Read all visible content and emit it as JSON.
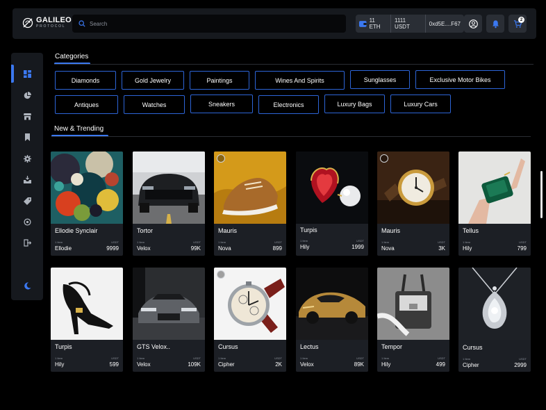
{
  "header": {
    "logo_name": "GALILEO",
    "logo_sub": "PROTOCOL",
    "search_placeholder": "Search",
    "wallet": {
      "eth": "11 ETH",
      "usdt": "1111 USDT",
      "address": "0xd5E....F67"
    },
    "notification_count": "",
    "cart_count": "2"
  },
  "sidebar": {
    "items": [
      {
        "icon": "dashboard-icon",
        "active": true
      },
      {
        "icon": "pie-chart-icon"
      },
      {
        "icon": "store-icon"
      },
      {
        "icon": "bookmark-icon"
      },
      {
        "icon": "settings-icon"
      },
      {
        "icon": "inbox-icon"
      },
      {
        "icon": "tag-icon"
      },
      {
        "icon": "refresh-icon"
      },
      {
        "icon": "logout-icon"
      },
      {
        "icon": "moon-icon"
      }
    ]
  },
  "categories": {
    "title": "Categories",
    "items": [
      "Diamonds",
      "Gold Jewelry",
      "Paintings",
      "Wines And Spirits",
      "Sunglasses",
      "Exclusive Motor Bikes",
      "Antiques",
      "Watches",
      "Sneakers",
      "Electronics",
      "Luxury Bags",
      "Luxury Cars"
    ]
  },
  "trending": {
    "title": "New & Trending",
    "item_label": "1 Item",
    "currency": "USDT",
    "cards": [
      {
        "title": "Ellodie Synclair",
        "creator": "Ellodie",
        "price": "9999",
        "image": "abstract-painting",
        "badge": false
      },
      {
        "title": "Tortor",
        "creator": "Velox",
        "price": "99K",
        "image": "muscle-car",
        "badge": false
      },
      {
        "title": "Mauris",
        "creator": "Nova",
        "price": "899",
        "image": "sneaker",
        "badge": true
      },
      {
        "title": "Turpis",
        "creator": "Hily",
        "price": "1999",
        "image": "ruby-jewelry",
        "badge": false
      },
      {
        "title": "Mauris",
        "creator": "Nova",
        "price": "3K",
        "image": "gold-watch",
        "badge": true
      },
      {
        "title": "Tellus",
        "creator": "Hily",
        "price": "799",
        "image": "wallet-hands",
        "badge": false
      },
      {
        "title": "Turpis",
        "creator": "Hily",
        "price": "599",
        "image": "heel-shoe",
        "badge": false
      },
      {
        "title": "GTS Velox..",
        "creator": "Velox",
        "price": "109K",
        "image": "supercar",
        "badge": false
      },
      {
        "title": "Cursus",
        "creator": "Cipher",
        "price": "2K",
        "image": "chrono-watch",
        "badge": true
      },
      {
        "title": "Lectus",
        "creator": "Velox",
        "price": "89K",
        "image": "gold-car",
        "badge": false
      },
      {
        "title": "Tempor",
        "creator": "Hily",
        "price": "499",
        "image": "handbag",
        "badge": false
      },
      {
        "title": "Cursus",
        "creator": "Cipher",
        "price": "2999",
        "image": "diamond-pendant",
        "badge": false
      }
    ]
  },
  "colors": {
    "accent": "#3b78f0",
    "chip_border": "#2d65d8",
    "panel": "#16191e",
    "card": "#1c1f25"
  }
}
